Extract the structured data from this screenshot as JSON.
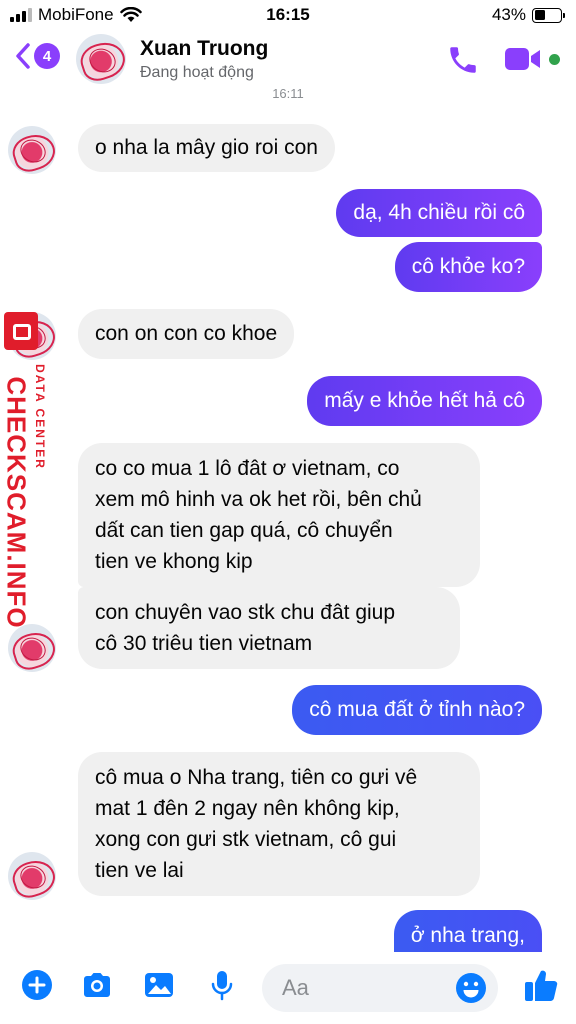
{
  "status_bar": {
    "carrier": "MobiFone",
    "time": "16:15",
    "battery_percent": "43%",
    "battery_level": 0.43
  },
  "header": {
    "back_count": "4",
    "contact_name": "Xuan Truong",
    "contact_status": "Đang hoạt động",
    "accent_color": "#8a3ffc"
  },
  "conversation": {
    "timestamp": "16:11",
    "messages": [
      {
        "sender": "contact",
        "text": "o nha la mây gio roi con"
      },
      {
        "sender": "me",
        "text": "dạ, 4h chiều rồi cô"
      },
      {
        "sender": "me",
        "text": "cô khỏe ko?"
      },
      {
        "sender": "contact",
        "text": "con on con co khoe"
      },
      {
        "sender": "me",
        "text": "mấy e khỏe hết hả cô"
      },
      {
        "sender": "contact",
        "lines": [
          "co co mua 1 lô đât ơ vietnam, co",
          "xem mô hinh va ok het rồi, bên chủ",
          "dất can tien gap quá, cô chuyển",
          "tien ve khong kip"
        ]
      },
      {
        "sender": "contact",
        "lines": [
          "con chuyên vao stk chu đât giup",
          "cô 30 triêu tien vietnam"
        ]
      },
      {
        "sender": "me",
        "text": "cô mua đất ở tỉnh nào?"
      },
      {
        "sender": "contact",
        "lines": [
          "cô mua o Nha trang, tiên co gưi vê",
          "mat 1 đên 2 ngay nên không kip,",
          "xong con gưi stk vietnam, cô gui",
          "tien ve lai"
        ]
      },
      {
        "sender": "me",
        "text": "ở nha trang,"
      }
    ]
  },
  "watermark": {
    "main": "CHECKSCAM.INFO",
    "sub": "DATA CENTER"
  },
  "composer": {
    "placeholder": "Aa"
  },
  "icons": [
    "plus-icon",
    "camera-icon",
    "photo-icon",
    "mic-icon",
    "emoji-icon",
    "like-icon",
    "phone-icon",
    "video-icon",
    "back-chevron-icon"
  ]
}
